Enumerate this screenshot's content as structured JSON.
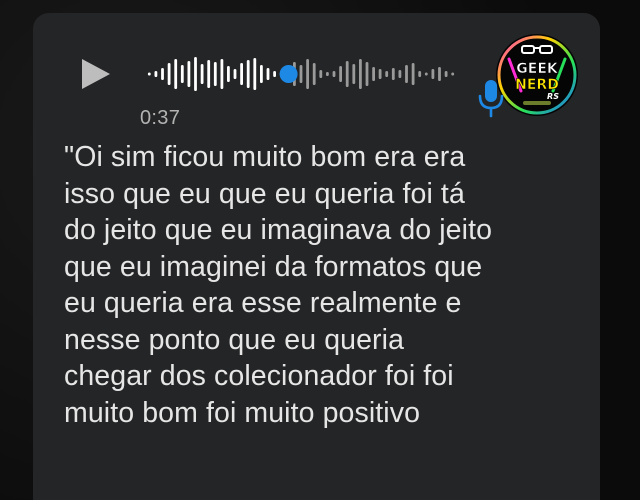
{
  "voice_message": {
    "duration": "0:37",
    "progress": 0.46,
    "played_color": "#ffffff",
    "unplayed_color": "#9a9a9a",
    "handle_color": "#1e88e5",
    "play_icon": "play-icon",
    "mic_icon": "microphone-icon"
  },
  "avatar": {
    "line1": "GEEK",
    "line2": "NERD",
    "line3": "RS"
  },
  "transcript": {
    "lines": [
      "\"Oi sim ficou muito bom era era",
      "isso que eu que eu queria foi tá",
      "do jeito que eu imaginava do jeito",
      "que eu imaginei da formatos que",
      "eu queria era esse realmente e",
      "nesse ponto que eu queria",
      "chegar dos colecionador foi foi",
      "muito bom foi muito positivo"
    ]
  },
  "colors": {
    "bubble": "#242526",
    "text": "#e6e6e6",
    "mic_blue": "#1e88e5"
  }
}
